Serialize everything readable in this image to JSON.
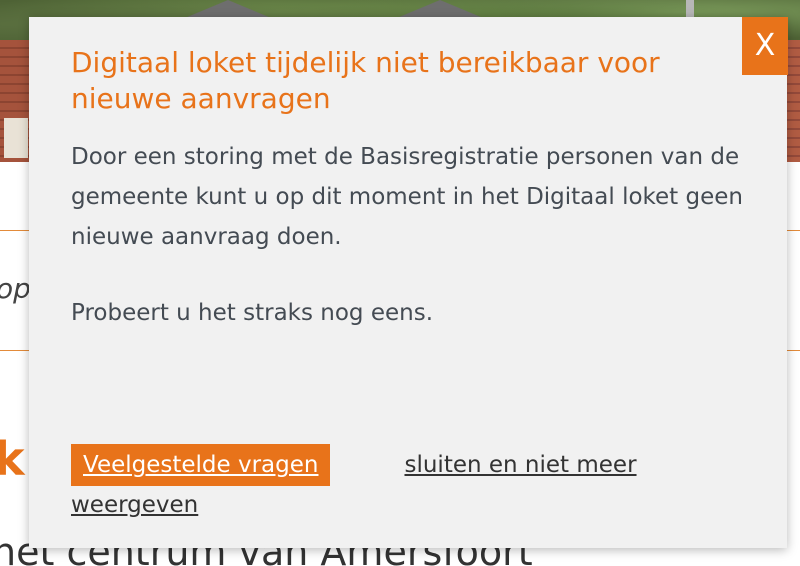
{
  "background": {
    "fragment_op": "op",
    "fragment_k": "k",
    "fragment_centrum": "het centrum van Amersfoort"
  },
  "modal": {
    "close_label": "X",
    "title": "Digitaal loket tijdelijk niet bereikbaar voor nieuwe aanvragen",
    "paragraphs": [
      "Door een storing met de Basisregistratie personen van de gemeente kunt u op dit moment in het Digitaal loket geen nieuwe aanvraag doen.",
      "Probeert u het straks nog eens."
    ],
    "faq_button_label": "Veelgestelde vragen",
    "dismiss_link_label": "sluiten en niet meer weergeven"
  },
  "colors": {
    "accent": "#e8731a",
    "modal_background": "#f1f1f1",
    "body_text": "#444b53"
  },
  "icons": {
    "close": "close-icon"
  }
}
